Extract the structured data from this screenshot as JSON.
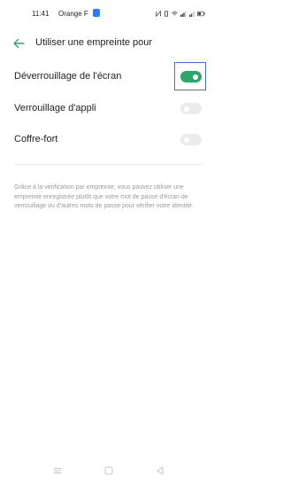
{
  "status_bar": {
    "time": "11:41",
    "carrier": "Orange F"
  },
  "header": {
    "title": "Utiliser une empreinte pour"
  },
  "settings": [
    {
      "label": "Déverrouillage de l'écran",
      "enabled": true
    },
    {
      "label": "Verrouillage d'appli",
      "enabled": false
    },
    {
      "label": "Coffre-fort",
      "enabled": false
    }
  ],
  "description": "Grâce à la vérification par empreinte, vous pouvez utiliser une empreinte enregistrée plutôt que votre mot de passe d'écran de verrouillage ou d'autres mots de passe pour vérifier votre identité.",
  "colors": {
    "accent": "#2ea66a",
    "toggle_off": "#ececec",
    "highlight": "#3f6fd8"
  }
}
